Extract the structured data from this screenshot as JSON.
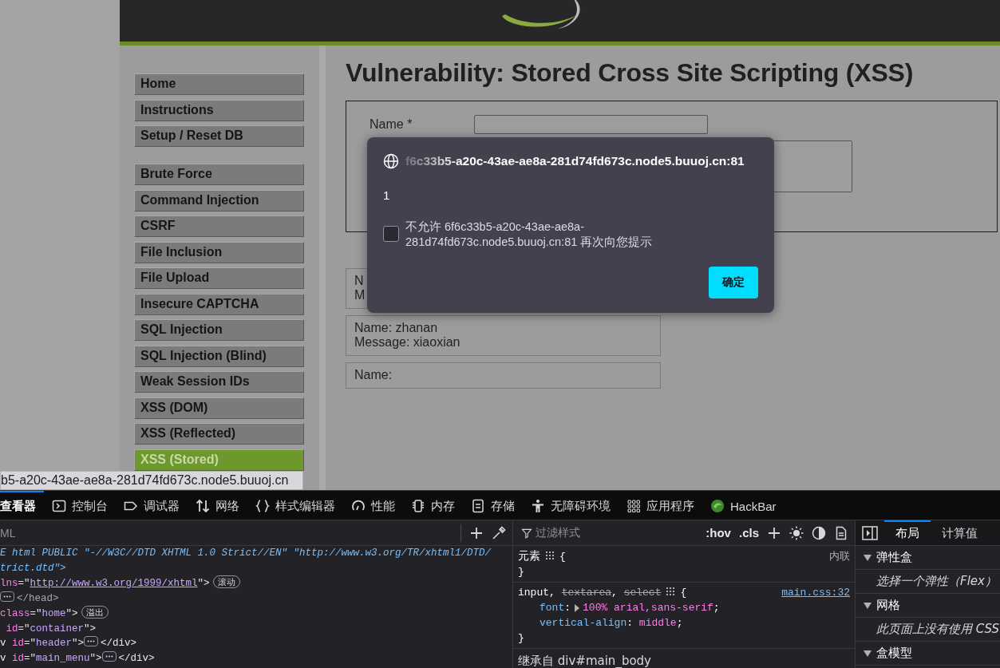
{
  "status_tooltip": "b5-a20c-43ae-ae8a-281d74fd673c.node5.buuoj.cn",
  "menu": {
    "groups": [
      [
        {
          "label": "Home",
          "selected": false
        },
        {
          "label": "Instructions",
          "selected": false
        },
        {
          "label": "Setup / Reset DB",
          "selected": false
        }
      ],
      [
        {
          "label": "Brute Force",
          "selected": false
        },
        {
          "label": "Command Injection",
          "selected": false
        },
        {
          "label": "CSRF",
          "selected": false
        },
        {
          "label": "File Inclusion",
          "selected": false
        },
        {
          "label": "File Upload",
          "selected": false
        },
        {
          "label": "Insecure CAPTCHA",
          "selected": false
        },
        {
          "label": "SQL Injection",
          "selected": false
        },
        {
          "label": "SQL Injection (Blind)",
          "selected": false
        },
        {
          "label": "Weak Session IDs",
          "selected": false
        },
        {
          "label": "XSS (DOM)",
          "selected": false
        },
        {
          "label": "XSS (Reflected)",
          "selected": false
        },
        {
          "label": "XSS (Stored)",
          "selected": true
        }
      ]
    ]
  },
  "page_title": "Vulnerability: Stored Cross Site Scripting (XSS)",
  "form": {
    "name_label": "Name *"
  },
  "entries": [
    {
      "lines": [
        "N",
        "M"
      ]
    },
    {
      "lines": [
        "Name: zhanan",
        "Message: xiaoxian"
      ]
    },
    {
      "lines": [
        "Name:"
      ]
    }
  ],
  "dialog": {
    "host": "f6c33b5-a20c-43ae-ae8a-281d74fd673c.node5.buuoj.cn:81",
    "message": "1",
    "checkbox": {
      "label": "不允许 6f6c33b5-a20c-43ae-ae8a-281d74fd673c.node5.buuoj.cn:81 再次向您提示",
      "checked": false
    },
    "button": "确定"
  },
  "devtools": {
    "tabs": [
      {
        "label": "查看器",
        "kind": "inspector",
        "selected": true
      },
      {
        "label": "控制台",
        "kind": "console",
        "selected": false
      },
      {
        "label": "调试器",
        "kind": "debugger",
        "selected": false
      },
      {
        "label": "网络",
        "kind": "network",
        "selected": false
      },
      {
        "label": "样式编辑器",
        "kind": "style",
        "selected": false
      },
      {
        "label": "性能",
        "kind": "performance",
        "selected": false
      },
      {
        "label": "内存",
        "kind": "memory",
        "selected": false
      },
      {
        "label": "存储",
        "kind": "storage",
        "selected": false
      },
      {
        "label": "无障碍环境",
        "kind": "accessibility",
        "selected": false
      },
      {
        "label": "应用程序",
        "kind": "application",
        "selected": false
      },
      {
        "label": "HackBar",
        "kind": "hackbar",
        "selected": false
      }
    ],
    "inspector": {
      "search_placeholder": "ML",
      "lines": [
        [
          {
            "kind": "doctype",
            "text": "E html PUBLIC \"-//W3C//DTD XHTML 1.0 Strict//EN\" \"http://www.w3.org/TR/xhtml1/DTD/"
          }
        ],
        [
          {
            "kind": "doctype",
            "text": "trict.dtd\">"
          }
        ],
        [
          {
            "kind": "attr",
            "text": "lns"
          },
          {
            "kind": "punct",
            "text": "=\""
          },
          {
            "kind": "link",
            "text": "http://www.w3.org/1999/xhtml"
          },
          {
            "kind": "punct",
            "text": "\">"
          },
          {
            "kind": "badge",
            "text": "滚动"
          }
        ],
        [
          {
            "kind": "collapsed"
          },
          {
            "kind": "dimtag",
            "text": "</head>"
          }
        ],
        [
          {
            "kind": "attr",
            "text": "class"
          },
          {
            "kind": "punct",
            "text": "=\""
          },
          {
            "kind": "value",
            "text": "home"
          },
          {
            "kind": "punct",
            "text": "\">"
          },
          {
            "kind": "badge",
            "text": "溢出"
          }
        ],
        [
          {
            "kind": "attr",
            "text": " id"
          },
          {
            "kind": "punct",
            "text": "=\""
          },
          {
            "kind": "value",
            "text": "container"
          },
          {
            "kind": "punct",
            "text": "\">"
          }
        ],
        [
          {
            "kind": "tag",
            "text": "v"
          },
          {
            "kind": "attr",
            "text": " id"
          },
          {
            "kind": "punct",
            "text": "=\""
          },
          {
            "kind": "value",
            "text": "header"
          },
          {
            "kind": "punct",
            "text": "\">"
          },
          {
            "kind": "collapsed"
          },
          {
            "kind": "tag",
            "text": "</div>"
          }
        ],
        [
          {
            "kind": "tag",
            "text": "v"
          },
          {
            "kind": "attr",
            "text": " id"
          },
          {
            "kind": "punct",
            "text": "=\""
          },
          {
            "kind": "value",
            "text": "main_menu"
          },
          {
            "kind": "punct",
            "text": "\">"
          },
          {
            "kind": "collapsed"
          },
          {
            "kind": "tag",
            "text": "</div>"
          }
        ]
      ]
    },
    "rules": {
      "filter_placeholder": "过滤样式",
      "toggles": [
        ":hov",
        ".cls"
      ],
      "items": [
        {
          "selector": [
            {
              "text": "元素",
              "struck": false
            }
          ],
          "open": "{",
          "close": "}",
          "source": "内联",
          "source_link": false
        },
        {
          "selector": [
            {
              "text": "input",
              "struck": false
            },
            {
              "text": ", ",
              "struck": false
            },
            {
              "text": "textarea",
              "struck": true
            },
            {
              "text": ", ",
              "struck": false
            },
            {
              "text": "select",
              "struck": true
            }
          ],
          "open": "{",
          "close": "}",
          "source": "main.css:32",
          "source_link": true,
          "declarations": [
            {
              "name": "font",
              "colon": ":",
              "value": "100% arial,sans-serif",
              "end": ";",
              "expandable": true
            },
            {
              "name": "vertical-align",
              "colon": ":",
              "value": "middle",
              "end": ";",
              "expandable": false
            }
          ]
        }
      ],
      "inherited": "继承自 div#main_body"
    },
    "layout": {
      "tabs": [
        {
          "label": "布局",
          "selected": true
        },
        {
          "label": "计算值",
          "selected": false
        }
      ],
      "sections": [
        {
          "title": "弹性盒",
          "expanded": true,
          "note": "选择一个弹性（Flex）"
        },
        {
          "title": "网格",
          "expanded": true,
          "note": "此页面上没有使用 CSS"
        },
        {
          "title": "盒模型",
          "expanded": true
        }
      ]
    }
  }
}
